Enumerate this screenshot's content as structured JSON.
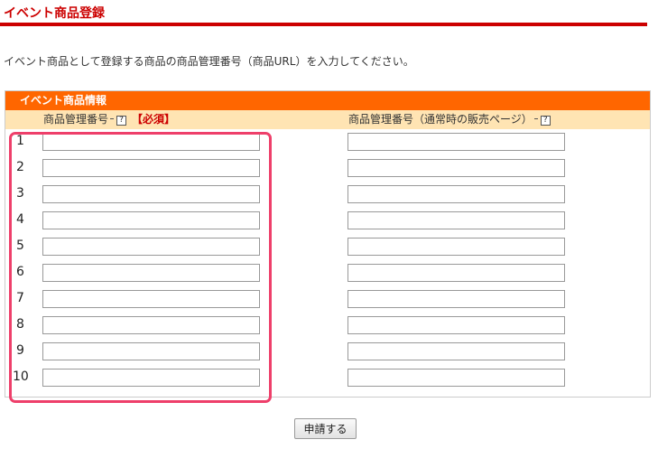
{
  "page": {
    "title": "イベント商品登録",
    "intro": "イベント商品として登録する商品の商品管理番号（商品URL）を入力してください。"
  },
  "panel": {
    "title": "イベント商品情報",
    "col_a_label": "商品管理番号",
    "col_a_required": "【必須】",
    "col_b_label": "商品管理番号（通常時の販売ページ）",
    "help_glyph": "?"
  },
  "rows": [
    {
      "num": "1",
      "value_a": "",
      "value_b": ""
    },
    {
      "num": "2",
      "value_a": "",
      "value_b": ""
    },
    {
      "num": "3",
      "value_a": "",
      "value_b": ""
    },
    {
      "num": "4",
      "value_a": "",
      "value_b": ""
    },
    {
      "num": "5",
      "value_a": "",
      "value_b": ""
    },
    {
      "num": "6",
      "value_a": "",
      "value_b": ""
    },
    {
      "num": "7",
      "value_a": "",
      "value_b": ""
    },
    {
      "num": "8",
      "value_a": "",
      "value_b": ""
    },
    {
      "num": "9",
      "value_a": "",
      "value_b": ""
    },
    {
      "num": "10",
      "value_a": "",
      "value_b": ""
    }
  ],
  "submit_label": "申請する",
  "colors": {
    "accent_red": "#cc0000",
    "panel_orange": "#ff6600",
    "header_tan": "#ffe4b3",
    "highlight_pink": "#ee3f6a"
  }
}
